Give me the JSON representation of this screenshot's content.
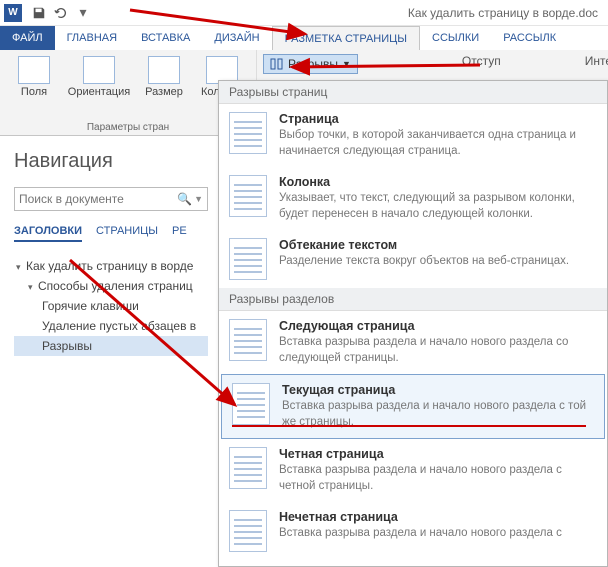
{
  "titlebar": {
    "app_letter": "W",
    "doc_title": "Как удалить страницу в ворде.doc"
  },
  "ribbon": {
    "tabs": {
      "file": "ФАЙЛ",
      "home": "ГЛАВНАЯ",
      "insert": "ВСТАВКА",
      "design": "ДИЗАЙН",
      "layout": "РАЗМЕТКА СТРАНИЦЫ",
      "references": "ССЫЛКИ",
      "mailings": "РАССЫЛК"
    },
    "group1": {
      "margins": "Поля",
      "orientation": "Ориентация",
      "size": "Размер",
      "columns": "Колонки",
      "label": "Параметры стран"
    },
    "breaks_label": "Разрывы",
    "indent_label": "Отступ",
    "spacing_label": "Интервал"
  },
  "dropdown": {
    "section1": "Разрывы страниц",
    "section2": "Разрывы разделов",
    "items": {
      "page": {
        "title": "Страница",
        "desc": "Выбор точки, в которой заканчивается одна страница и начинается следующая страница."
      },
      "column": {
        "title": "Колонка",
        "desc": "Указывает, что текст, следующий за разрывом колонки, будет перенесен в начало следующей колонки."
      },
      "textwrap": {
        "title": "Обтекание текстом",
        "desc": "Разделение текста вокруг объектов на веб-страницах."
      },
      "nextpage": {
        "title": "Следующая страница",
        "desc": "Вставка разрыва раздела и начало нового раздела со следующей страницы."
      },
      "continuous": {
        "title": "Текущая страница",
        "desc": "Вставка разрыва раздела и начало нового раздела с той же страницы."
      },
      "even": {
        "title": "Четная страница",
        "desc": "Вставка разрыва раздела и начало нового раздела с четной страницы."
      },
      "odd": {
        "title": "Нечетная страница",
        "desc": "Вставка разрыва раздела и начало нового раздела с"
      }
    }
  },
  "nav": {
    "title": "Навигация",
    "search_placeholder": "Поиск в документе",
    "tabs": {
      "headings": "ЗАГОЛОВКИ",
      "pages": "СТРАНИЦЫ",
      "results": "РЕ"
    },
    "tree": {
      "root": "Как удалить страницу в ворде",
      "n1": "Способы удаления страниц",
      "n1a": "Горячие клавиши",
      "n1b": "Удаление пустых абзацев в",
      "n1c": "Разрывы"
    }
  }
}
